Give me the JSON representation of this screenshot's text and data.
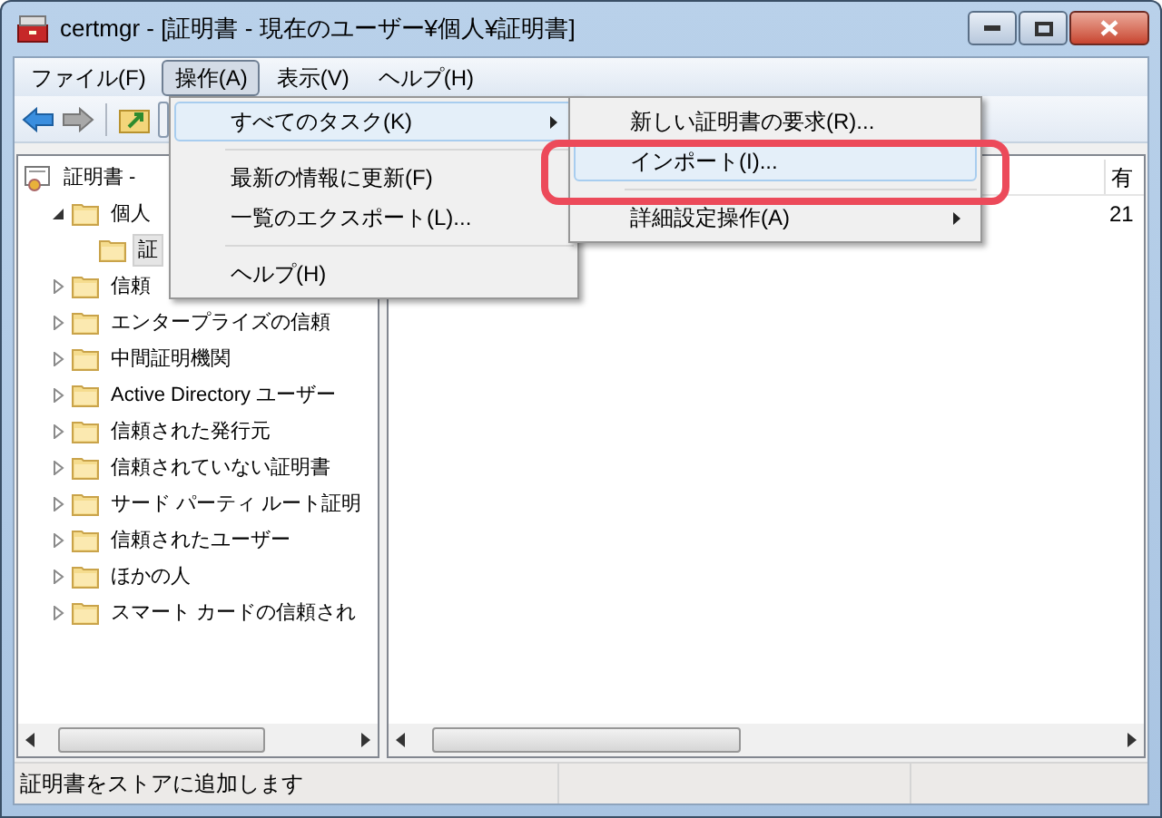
{
  "window": {
    "title": "certmgr - [証明書 - 現在のユーザー¥個人¥証明書]"
  },
  "menu_bar": [
    {
      "label": "ファイル(F)",
      "selected": false
    },
    {
      "label": "操作(A)",
      "selected": true
    },
    {
      "label": "表示(V)",
      "selected": false
    },
    {
      "label": "ヘルプ(H)",
      "selected": false
    }
  ],
  "menu": [
    {
      "kind": "item",
      "label": "すべてのタスク(K)",
      "submenu": true,
      "selected": true
    },
    {
      "kind": "separator"
    },
    {
      "kind": "item",
      "label": "最新の情報に更新(F)",
      "submenu": false,
      "selected": false
    },
    {
      "kind": "item",
      "label": "一覧のエクスポート(L)...",
      "submenu": false,
      "selected": false
    },
    {
      "kind": "separator"
    },
    {
      "kind": "item",
      "label": "ヘルプ(H)",
      "submenu": false,
      "selected": false
    }
  ],
  "submenu": [
    {
      "kind": "item",
      "label": "新しい証明書の要求(R)...",
      "submenu": false,
      "selected": false
    },
    {
      "kind": "item",
      "label": "インポート(I)...",
      "submenu": false,
      "selected": true
    },
    {
      "kind": "separator"
    },
    {
      "kind": "item",
      "label": "詳細設定操作(A)",
      "submenu": true,
      "selected": false
    }
  ],
  "tree": {
    "label": "証明書 -",
    "children": [
      {
        "label": "個人",
        "expanded": true,
        "selected": false,
        "children": [
          {
            "label": "証",
            "selected": true
          }
        ]
      },
      {
        "label": "信頼",
        "expanded": false,
        "selected": false
      },
      {
        "label": "エンタープライズの信頼",
        "expanded": false,
        "selected": false
      },
      {
        "label": "中間証明機関",
        "expanded": false,
        "selected": false
      },
      {
        "label": "Active Directory ユーザー",
        "expanded": false,
        "selected": false
      },
      {
        "label": "信頼された発行元",
        "expanded": false,
        "selected": false
      },
      {
        "label": "信頼されていない証明書",
        "expanded": false,
        "selected": false
      },
      {
        "label": "サード パーティ ルート証明",
        "expanded": false,
        "selected": false
      },
      {
        "label": "信頼されたユーザー",
        "expanded": false,
        "selected": false
      },
      {
        "label": "ほかの人",
        "expanded": false,
        "selected": false
      },
      {
        "label": "スマート カードの信頼され",
        "expanded": false,
        "selected": false
      }
    ]
  },
  "list": {
    "columns": [
      "有"
    ],
    "rows": [
      [
        "21"
      ]
    ]
  },
  "status_bar": [
    "証明書をストアに追加します"
  ]
}
